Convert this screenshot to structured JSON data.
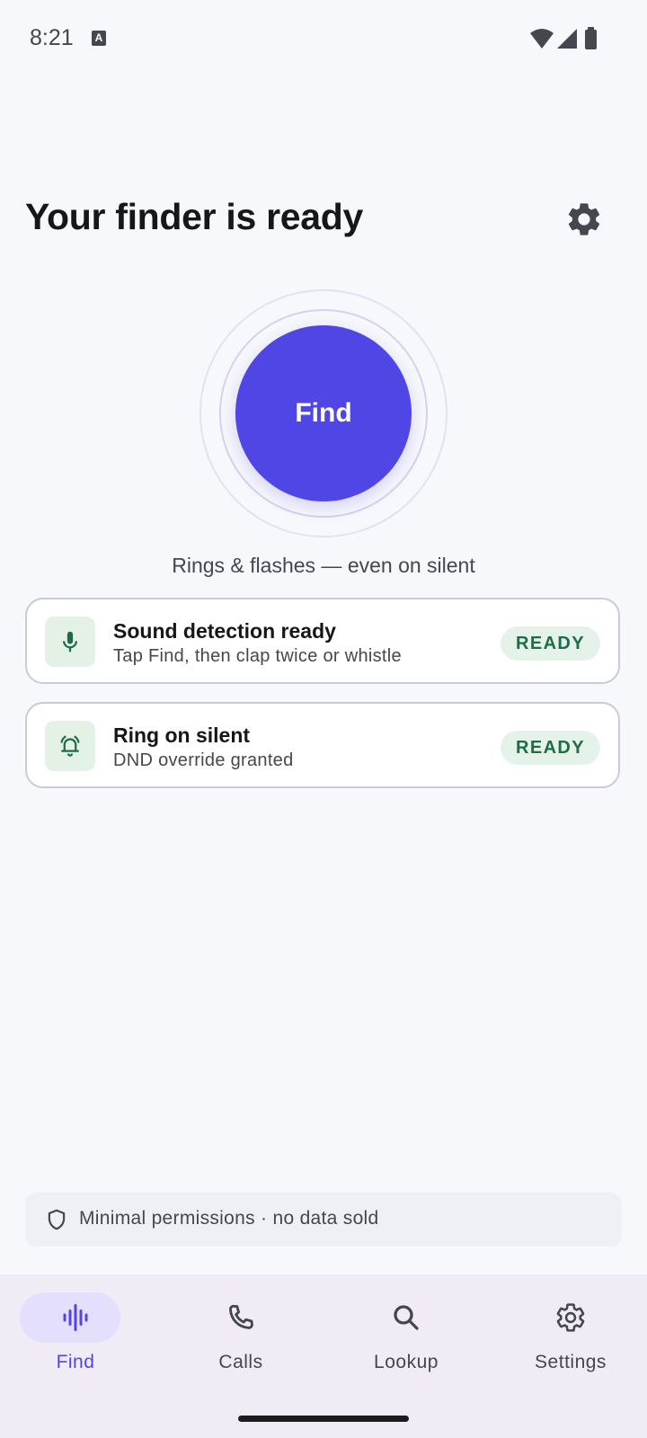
{
  "status": {
    "time": "8:21"
  },
  "header": {
    "title": "Your finder is ready"
  },
  "find_button": {
    "label": "Find"
  },
  "subtitle": "Rings & flashes — even on silent",
  "cards": [
    {
      "title": "Sound detection ready",
      "subtitle": "Tap Find, then clap twice or whistle",
      "badge": "READY",
      "icon": "microphone-icon"
    },
    {
      "title": "Ring on silent",
      "subtitle": "DND override granted",
      "badge": "READY",
      "icon": "bell-ring-icon"
    }
  ],
  "privacy": {
    "text": "Minimal permissions · no data sold",
    "icon": "shield-icon"
  },
  "nav": {
    "items": [
      {
        "label": "Find",
        "icon": "waveform-icon",
        "active": true
      },
      {
        "label": "Calls",
        "icon": "phone-icon",
        "active": false
      },
      {
        "label": "Lookup",
        "icon": "search-icon",
        "active": false
      },
      {
        "label": "Settings",
        "icon": "gear-icon",
        "active": false
      }
    ]
  },
  "colors": {
    "accent": "#4f46e5",
    "ready_green": "#1e6d44",
    "badge_bg": "#e5f2e9",
    "nav_bg": "#f1ebf6"
  }
}
